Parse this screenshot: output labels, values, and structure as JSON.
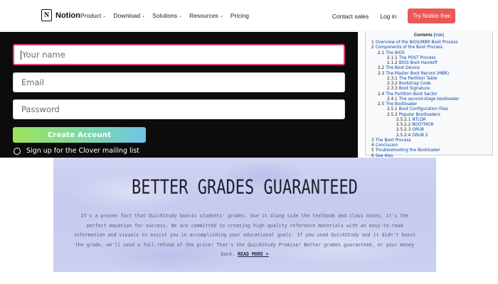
{
  "notion": {
    "logo_text": "Notion",
    "logo_letter": "N",
    "menu": [
      {
        "label": "Product",
        "has_dropdown": true
      },
      {
        "label": "Download",
        "has_dropdown": true
      },
      {
        "label": "Solutions",
        "has_dropdown": true
      },
      {
        "label": "Resources",
        "has_dropdown": true
      },
      {
        "label": "Pricing",
        "has_dropdown": false
      }
    ],
    "contact_sales": "Contact sales",
    "login": "Log in",
    "cta": "Try Notion free",
    "cta_color": "#eb5757"
  },
  "signup": {
    "name_placeholder": "Your name",
    "email_placeholder": "Email",
    "password_placeholder": "Password",
    "create_button": "Create Account",
    "mailing_label": "Sign up for the Clover mailing list",
    "focus_color": "#e0427f"
  },
  "toc": {
    "title": "Contents",
    "hide": "[hide]",
    "items": [
      {
        "num": "1",
        "label": "Overview of the BIOS/MBR Boot Process",
        "level": 0
      },
      {
        "num": "2",
        "label": "Components of the Boot Process",
        "level": 0
      },
      {
        "num": "2.1",
        "label": "The BIOS",
        "level": 1
      },
      {
        "num": "2.1.1",
        "label": "The POST Process",
        "level": 2
      },
      {
        "num": "2.1.2",
        "label": "BIOS Boot Handoff",
        "level": 2
      },
      {
        "num": "2.2",
        "label": "The Boot Device",
        "level": 1
      },
      {
        "num": "2.3",
        "label": "The Master Boot Record (MBR)",
        "level": 1
      },
      {
        "num": "2.3.1",
        "label": "The Partition Table",
        "level": 2
      },
      {
        "num": "2.3.2",
        "label": "Bootstrap Code",
        "level": 2
      },
      {
        "num": "2.3.3",
        "label": "Boot Signature",
        "level": 2
      },
      {
        "num": "2.4",
        "label": "The Partition Boot Sector",
        "level": 1
      },
      {
        "num": "2.4.1",
        "label": "The second-stage bootloader",
        "level": 2
      },
      {
        "num": "2.5",
        "label": "The Bootloader",
        "level": 1
      },
      {
        "num": "2.5.1",
        "label": "Boot Configuration Files",
        "level": 2
      },
      {
        "num": "2.5.2",
        "label": "Popular Bootloaders",
        "level": 2
      },
      {
        "num": "2.5.2.1",
        "label": "NTLDR",
        "level": 3
      },
      {
        "num": "2.5.2.2",
        "label": "BOOTMGR",
        "level": 3
      },
      {
        "num": "2.5.2.3",
        "label": "GRUB",
        "level": 3
      },
      {
        "num": "2.5.2.4",
        "label": "GRUB 2",
        "level": 3
      },
      {
        "num": "3",
        "label": "The Boot Process",
        "level": 0
      },
      {
        "num": "4",
        "label": "Conclusion",
        "level": 0
      },
      {
        "num": "5",
        "label": "Troubleshooting the Bootloader",
        "level": 0
      },
      {
        "num": "6",
        "label": "See Also",
        "level": 0
      }
    ]
  },
  "banner": {
    "title": "BETTER GRADES GUARANTEED",
    "body": "It's a proven fact that QuickStudy boosts students' grades. Use it along side the textbook and class notes, it's the perfect equation for success. We are committed to creating high quality reference materials with an easy-to-read information and visuals to assist you in accomplishing your educational goals. If you used QuickStudy and it didn't boost the grade, we'll send a full-refund of the price! That's the QuickStudy Promise! Better grades guaranteed, or your money back.",
    "link": "READ MORE >"
  }
}
